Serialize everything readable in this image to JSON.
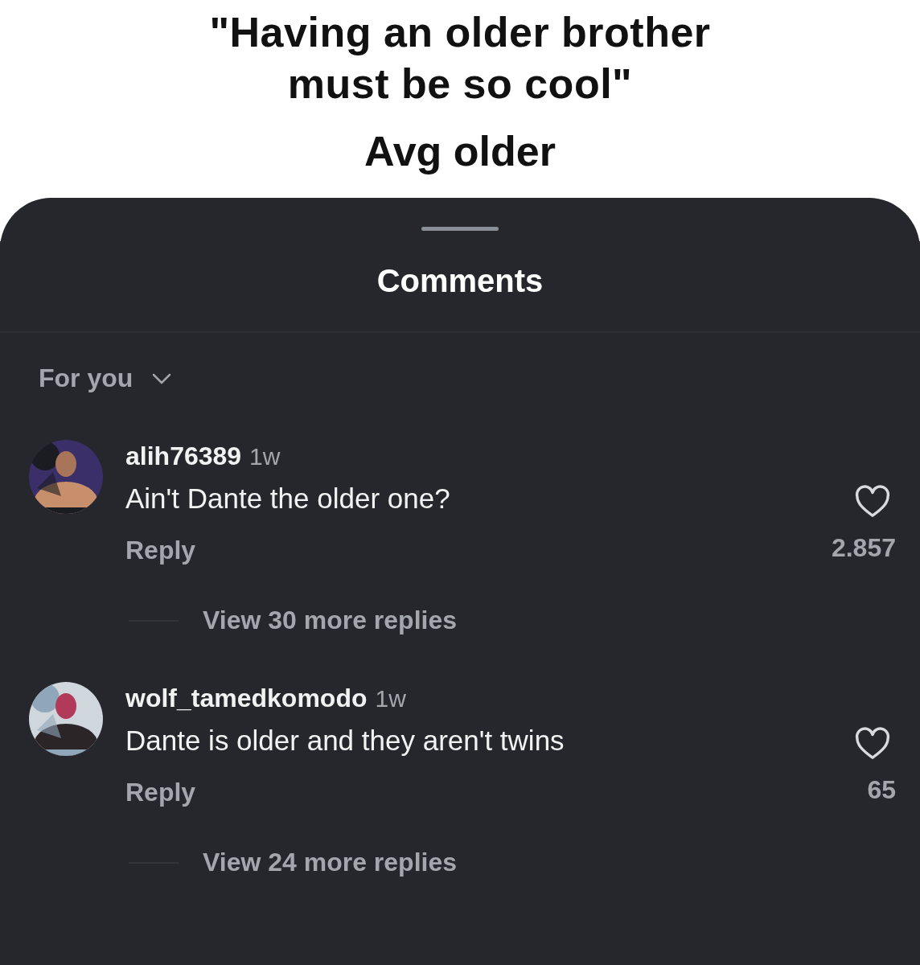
{
  "meme": {
    "caption": "\"Having an older brother must be so cool\"",
    "subcaption": "Avg older"
  },
  "sheet": {
    "title": "Comments",
    "sort": "For you"
  },
  "comments": [
    {
      "username": "alih76389",
      "time": "1w",
      "text": "Ain't Dante the older one?",
      "reply": "Reply",
      "likes": "2.857",
      "liked": false,
      "more_replies": "View 30 more replies"
    },
    {
      "username": "wolf_tamedkomodo",
      "time": "1w",
      "text": "Dante is older and they aren't twins",
      "reply": "Reply",
      "likes": "65",
      "liked": false,
      "more_replies": "View 24 more replies"
    }
  ]
}
